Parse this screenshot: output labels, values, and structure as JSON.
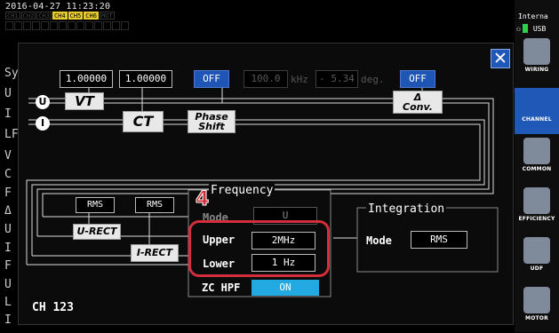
{
  "status_bar": {
    "timestamp": "2016-04-27 11:23:20",
    "channels": [
      {
        "label": "CH1",
        "on": false
      },
      {
        "label": "CH2",
        "on": false
      },
      {
        "label": "CH3",
        "on": false
      },
      {
        "label": "CH4",
        "on": true
      },
      {
        "label": "CH5",
        "on": true
      },
      {
        "label": "CH6",
        "on": true
      },
      {
        "label": "MOT",
        "on": false
      }
    ],
    "bit_row": [
      "U",
      "I",
      "U",
      "I",
      "U",
      "I",
      "U",
      "I",
      "U",
      "I",
      "U",
      "I",
      "A",
      "B"
    ]
  },
  "side_panel": {
    "top_label": "Interna",
    "usb_label": "USB",
    "buttons": [
      {
        "label": "WIRING",
        "active": false,
        "icon": "wiring-icon"
      },
      {
        "label": "CHANNEL",
        "active": true,
        "icon": "channel-icon"
      },
      {
        "label": "COMMON",
        "active": false,
        "icon": "common-icon"
      },
      {
        "label": "EFFICIENCY",
        "active": false,
        "icon": "efficiency-icon"
      },
      {
        "label": "UDF",
        "active": false,
        "icon": "udf-icon"
      },
      {
        "label": "MOTOR",
        "active": false,
        "icon": "motor-icon"
      }
    ]
  },
  "background_labels": [
    "Sy",
    "U",
    "I",
    "LF",
    "V",
    "C",
    "F",
    "Δ",
    "U",
    "I",
    "F",
    "U",
    "L",
    "I"
  ],
  "dialog": {
    "vt_value": "1.00000",
    "ct_value": "1.00000",
    "phase_shift_state": "OFF",
    "phase_freq": "100.0",
    "phase_freq_unit": "kHz",
    "phase_deg": "- 5.34",
    "phase_deg_unit": "deg.",
    "delta_conv_state": "OFF",
    "vt_label": "VT",
    "ct_label": "CT",
    "phase_shift_label_1": "Phase",
    "phase_shift_label_2": "Shift",
    "delta_conv_label_1": "Δ",
    "delta_conv_label_2": "Conv.",
    "u_marker": "U",
    "i_marker": "I",
    "u_rect_mode": "RMS",
    "i_rect_mode": "RMS",
    "u_rect_label": "U-RECT",
    "i_rect_label": "I-RECT",
    "frequency": {
      "title": "Frequency",
      "mode_label": "Mode",
      "mode_value": "U",
      "upper_label": "Upper",
      "upper_value": "2MHz",
      "lower_label": "Lower",
      "lower_value": "1 Hz",
      "zc_hpf_label": "ZC HPF",
      "zc_hpf_value": "ON"
    },
    "integration": {
      "title": "Integration",
      "mode_label": "Mode",
      "mode_value": "RMS"
    },
    "step_marker": "4",
    "channel_label": "CH 123",
    "close_symbol": "✕"
  }
}
